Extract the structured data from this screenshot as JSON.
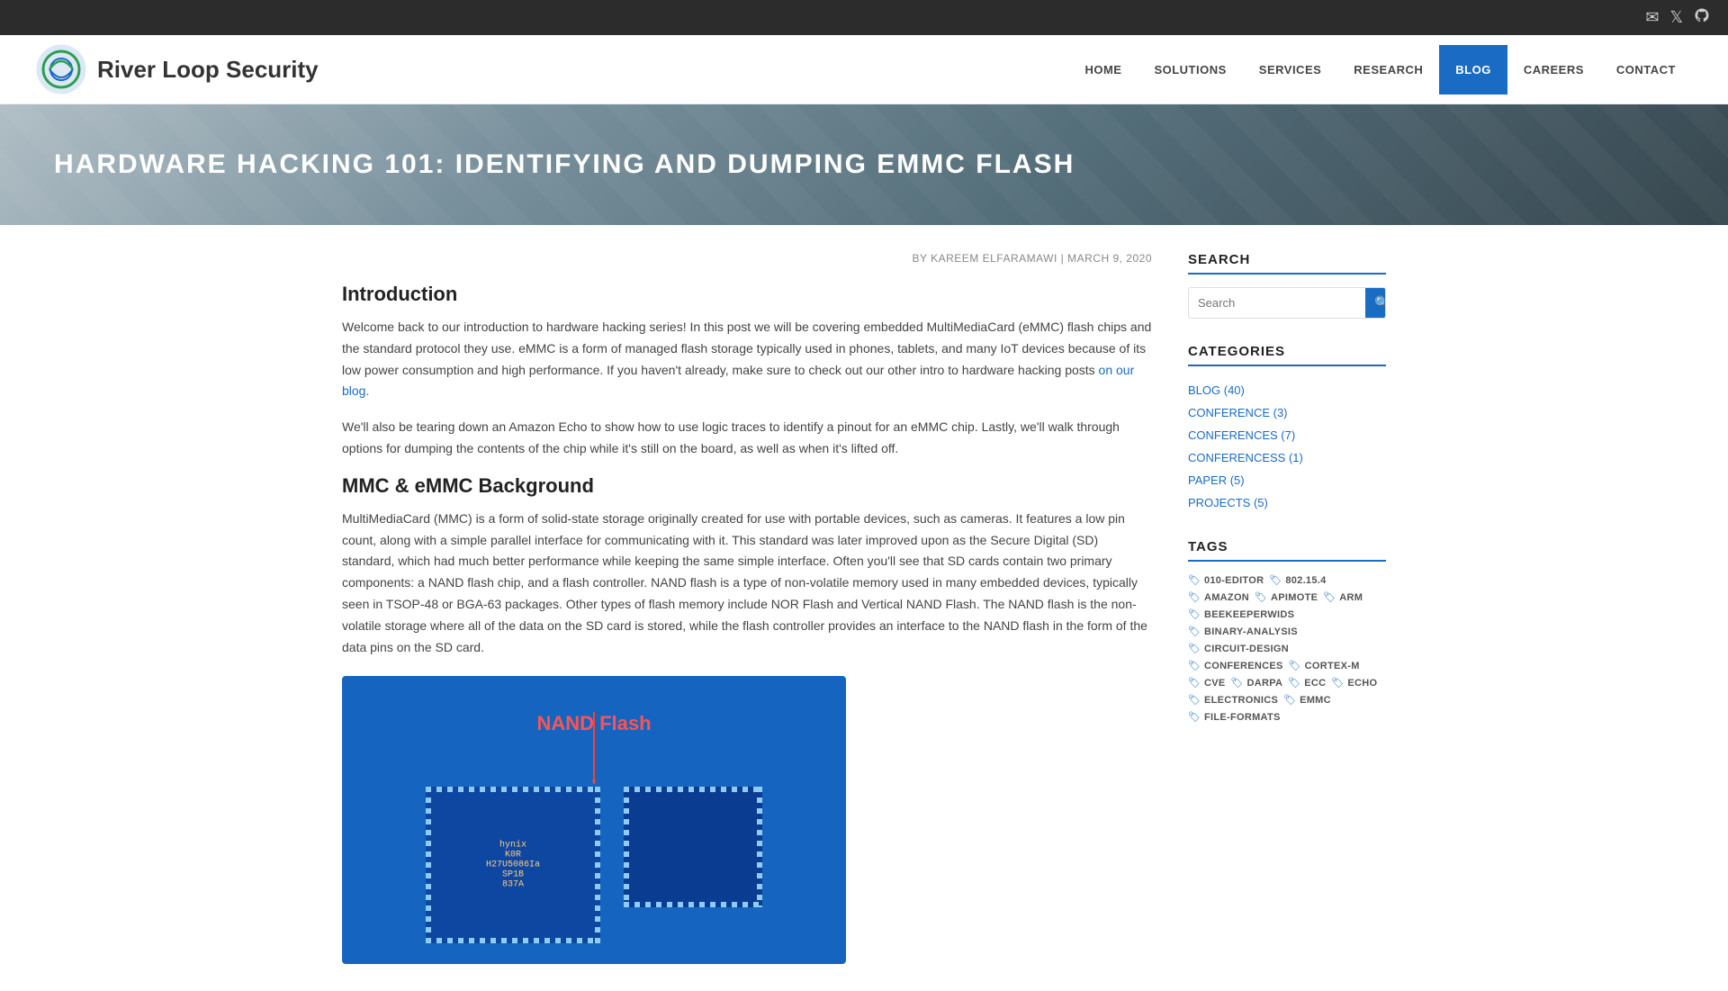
{
  "topbar": {
    "icons": [
      {
        "name": "email-icon",
        "symbol": "✉"
      },
      {
        "name": "twitter-icon",
        "symbol": "🐦"
      },
      {
        "name": "github-icon",
        "symbol": "⚙"
      }
    ]
  },
  "nav": {
    "logo_text": "River Loop Security",
    "items": [
      {
        "label": "HOME",
        "active": false
      },
      {
        "label": "SOLUTIONS",
        "active": false
      },
      {
        "label": "SERVICES",
        "active": false
      },
      {
        "label": "RESEARCH",
        "active": false
      },
      {
        "label": "BLOG",
        "active": true
      },
      {
        "label": "CAREERS",
        "active": false
      },
      {
        "label": "CONTACT",
        "active": false
      }
    ]
  },
  "hero": {
    "title": "HARDWARE HACKING 101: IDENTIFYING AND DUMPING EMMC FLASH"
  },
  "article": {
    "meta": "BY KAREEM ELFARAMAWI | MARCH 9, 2020",
    "intro_heading": "Introduction",
    "intro_p1": "Welcome back to our introduction to hardware hacking series! In this post we will be covering embedded MultiMediaCard (eMMC) flash chips and the standard protocol they use. eMMC is a form of managed flash storage typically used in phones, tablets, and many IoT devices because of its low power consumption and high performance. If you haven't already, make sure to check out our other intro to hardware hacking posts",
    "intro_link": "on our blog.",
    "intro_p2": "We'll also be tearing down an Amazon Echo to show how to use logic traces to identify a pinout for an eMMC chip. Lastly, we'll walk through options for dumping the contents of the chip while it's still on the board, as well as when it's lifted off.",
    "bg_heading": "MMC & eMMC Background",
    "bg_p1": "MultiMediaCard (MMC) is a form of solid-state storage originally created for use with portable devices, such as cameras. It features a low pin count, along with a simple parallel interface for communicating with it. This standard was later improved upon as the Secure Digital (SD) standard, which had much better performance while keeping the same simple interface. Often you'll see that SD cards contain two primary components: a NAND flash chip, and a flash controller. NAND flash is a type of non-volatile memory used in many embedded devices, typically seen in TSOP-48 or BGA-63 packages. Other types of flash memory include NOR Flash and Vertical NAND Flash. The NAND flash is the non-volatile storage where all of the data on the SD card is stored, while the flash controller provides an interface to the NAND flash in the form of the data pins on the SD card.",
    "image_label": "NAND Flash",
    "chip_text": "hynix\nK0R\nH27U5086Ia\nSP1B\n837A"
  },
  "sidebar": {
    "search_heading": "SEARCH",
    "search_placeholder": "Search",
    "categories_heading": "CATEGORIES",
    "categories": [
      {
        "label": "BLOG (40)"
      },
      {
        "label": "CONFERENCE (3)"
      },
      {
        "label": "CONFERENCES (7)"
      },
      {
        "label": "CONFERENCESS (1)"
      },
      {
        "label": "PAPER (5)"
      },
      {
        "label": "PROJECTS (5)"
      }
    ],
    "tags_heading": "TAGS",
    "tags": [
      {
        "label": "010-EDITOR"
      },
      {
        "label": "802.15.4"
      },
      {
        "label": "AMAZON"
      },
      {
        "label": "APIMOTE"
      },
      {
        "label": "ARM"
      },
      {
        "label": "BEEKEEPERWIDS"
      },
      {
        "label": "BINARY-ANALYSIS"
      },
      {
        "label": "CIRCUIT-DESIGN"
      },
      {
        "label": "CONFERENCES"
      },
      {
        "label": "CORTEX-M"
      },
      {
        "label": "CVE"
      },
      {
        "label": "DARPA"
      },
      {
        "label": "ECC"
      },
      {
        "label": "ECHO"
      },
      {
        "label": "ELECTRONICS"
      },
      {
        "label": "EMMC"
      },
      {
        "label": "FILE-FORMATS"
      }
    ]
  }
}
